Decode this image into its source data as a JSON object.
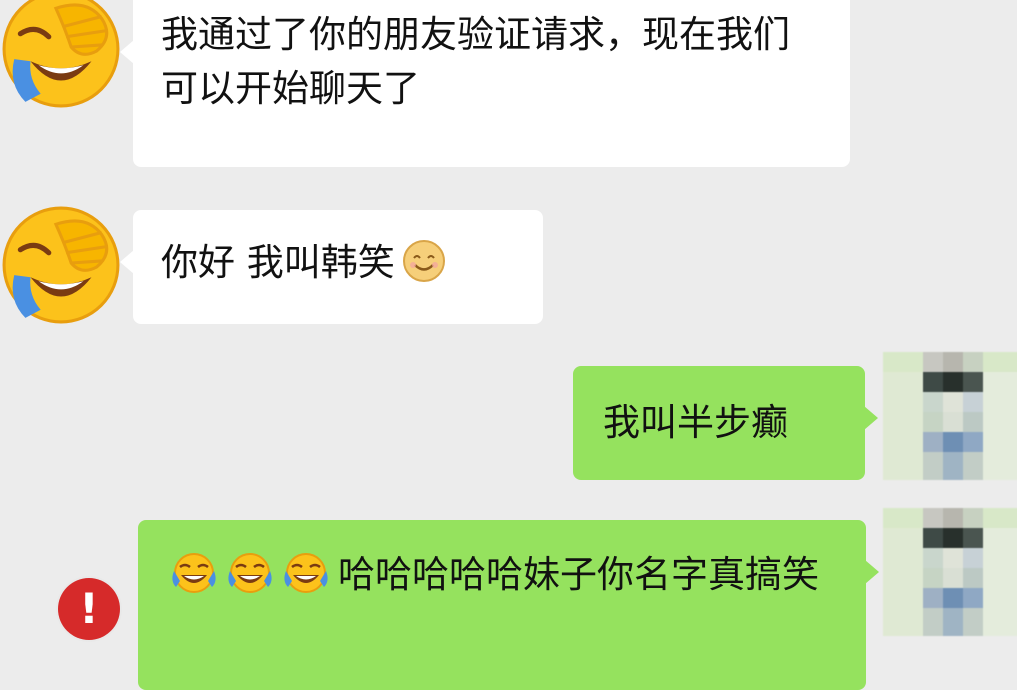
{
  "chat": {
    "messages": [
      {
        "sender": "other",
        "text": "我通过了你的朋友验证请求，现在我们可以开始聊天了"
      },
      {
        "sender": "other",
        "text": "你好 我叫韩笑",
        "emoji": "smile-icon"
      },
      {
        "sender": "self",
        "text": "我叫半步癫"
      },
      {
        "sender": "self",
        "text": "哈哈哈哈哈妹子你名字真搞笑",
        "emoji_prefix": [
          "laugh-icon",
          "laugh-icon",
          "laugh-icon"
        ],
        "status": "failed"
      }
    ],
    "error_symbol": "!"
  },
  "colors": {
    "background": "#ececec",
    "incoming_bubble": "#ffffff",
    "outgoing_bubble": "#95e25e",
    "error": "#d62a2a"
  },
  "icons": {
    "other_avatar": "face-palm-laughing-emoji-icon",
    "self_avatar": "pixelated-avatar",
    "error": "exclamation-icon"
  }
}
